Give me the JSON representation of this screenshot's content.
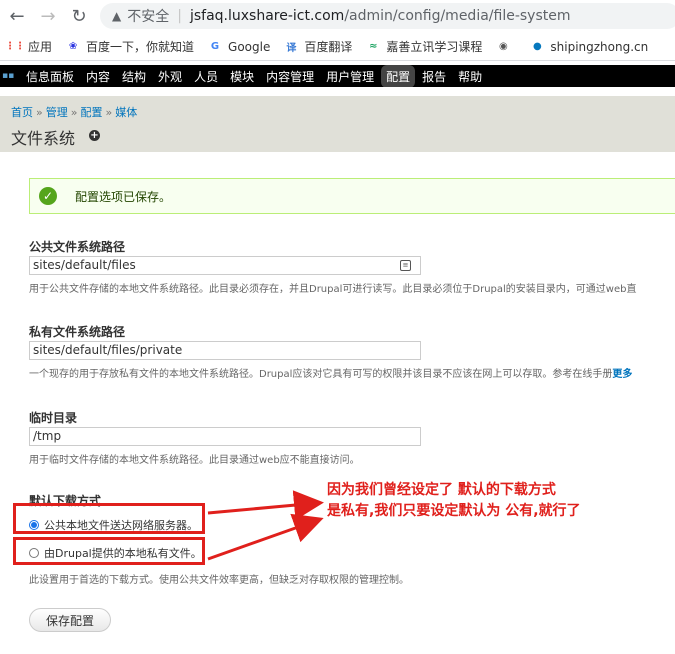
{
  "browser": {
    "insecure_label": "不安全",
    "separator": "|",
    "url_host": "jsfaq.luxshare-ict.com",
    "url_path": "/admin/config/media/file-system"
  },
  "bookmarks": [
    {
      "label": "应用",
      "icon": "apps-grid-icon",
      "color": "#ea4335"
    },
    {
      "label": "百度一下，你就知道",
      "icon": "baidu-paw-icon",
      "color": "#2932e1"
    },
    {
      "label": "Google",
      "icon": "google-g-icon",
      "color": "#4285f4"
    },
    {
      "label": "百度翻译",
      "icon": "translate-icon",
      "color": "#3a7bd5"
    },
    {
      "label": "嘉善立讯学习课程",
      "icon": "course-icon",
      "color": "#1aa260"
    },
    {
      "label": "",
      "icon": "globe-icon",
      "color": "#555555"
    },
    {
      "label": "shipingzhong.cn",
      "icon": "drupal-drop-icon",
      "color": "#0678be"
    }
  ],
  "toolbar": {
    "items": [
      "信息面板",
      "内容",
      "结构",
      "外观",
      "人员",
      "模块",
      "内容管理",
      "用户管理",
      "配置",
      "报告",
      "帮助"
    ],
    "active_index": 8
  },
  "header": {
    "breadcrumb": [
      "首页",
      "管理",
      "配置",
      "媒体"
    ],
    "breadcrumb_sep": "»",
    "title": "文件系统"
  },
  "message": "配置选项已保存。",
  "public_path": {
    "label": "公共文件系统路径",
    "value": "sites/default/files",
    "description": "用于公共文件存储的本地文件系统路径。此目录必须存在，并且Drupal可进行读写。此目录必须位于Drupal的安装目录内，可通过web直"
  },
  "private_path": {
    "label": "私有文件系统路径",
    "value": "sites/default/files/private",
    "description": "一个现存的用于存放私有文件的本地文件系统路径。Drupal应该对它具有可写的权限并该目录不应该在网上可以存取。参考在线手册",
    "more_link": "更多"
  },
  "temp_dir": {
    "label": "临时目录",
    "value": "/tmp",
    "description": "用于临时文件存储的本地文件系统路径。此目录通过web应不能直接访问。"
  },
  "download_method": {
    "label": "默认下载方式",
    "options": [
      "公共本地文件送达网络服务器。",
      "由Drupal提供的本地私有文件。"
    ],
    "selected_index": 0,
    "description": "此设置用于首选的下载方式。使用公共文件效率更高，但缺乏对存取权限的管理控制。"
  },
  "save_button": "保存配置",
  "annotation": {
    "line1": "因为我们曾经设定了 默认的下载方式",
    "line2": "是私有,我们只要设定默认为 公有,就行了",
    "color": "#e0201c"
  }
}
